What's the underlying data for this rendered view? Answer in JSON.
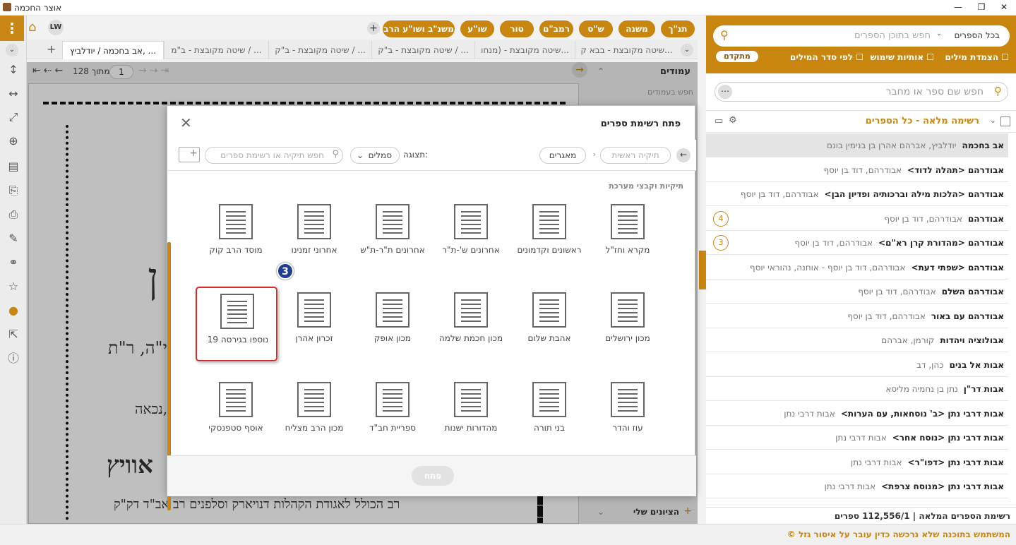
{
  "window": {
    "title": "אוצר החכמה",
    "minimize": "—",
    "maximize": "❐",
    "close": "✕"
  },
  "top": {
    "avatar": "LW",
    "nav_pills": [
      "תנ\"ך",
      "משנה",
      "ש\"ס",
      "רמב\"ם",
      "טור",
      "שו\"ע",
      "משנ\"ב ושו\"ע הרב"
    ]
  },
  "tabs": [
    "אב בחכמה / יודלביץ, ...",
    "שיטה מקובצת - ב\"מ / ...",
    "שיטה מקובצת - ב\"ק / ...",
    "שיטה מקובצת - ב\"ק / ...",
    "שיטה מקובצת - (מנחו...",
    "שיטה מקובצת - בבא ק..."
  ],
  "pager": {
    "current": "1",
    "total_label": "מתוך 128"
  },
  "pages_panel": {
    "title": "עמודים",
    "search_placeholder": "חפש בעמודים",
    "bookmarks": "הציונים שלי"
  },
  "right": {
    "scope": "בכל הספרים",
    "search_placeholder": "חפש בתוכן הספרים",
    "opts": [
      "הצמדת מילים",
      "אותיות שימוש",
      "לפי סדר המילים"
    ],
    "advanced": "מתקדם",
    "book_search_placeholder": "חפש שם ספר או מחבר",
    "list_title": "רשימה מלאה - כל הספרים",
    "rows": [
      {
        "b": "אב בחכמה",
        "a": "יודלביץ, אברהם אהרן בן בנימין בונם"
      },
      {
        "b": "אבודרהם <תהלה לדוד>",
        "a": "אבודרהם, דוד בן יוסף"
      },
      {
        "b": "אבודרהם <הלכות מילה וברכותיה ופדיון הבן>",
        "a": "אבודרהם, דוד בן יוסף"
      },
      {
        "b": "אבודרהם",
        "a": "אבודרהם, דוד בן יוסף",
        "n": "4"
      },
      {
        "b": "אבודרהם <מהדורת קרן רא\"ם>",
        "a": "אבודרהם, דוד בן יוסף",
        "n": "3"
      },
      {
        "b": "אבודרהם <שפתי דעת>",
        "a": "אבודרהם, דוד בן יוסף - אוחנה, נהוראי יוסף"
      },
      {
        "b": "אבודרהם השלם",
        "a": "אבודרהם, דוד בן יוסף"
      },
      {
        "b": "אבודרהם עם באור",
        "a": "אבודרהם, דוד בן יוסף"
      },
      {
        "b": "אבולוציה ויהדות",
        "a": "קורמן, אברהם"
      },
      {
        "b": "אבות אל בנים",
        "a": "כהן, דב"
      },
      {
        "b": "אבות דר\"ן",
        "a": "נתן בן נחמיה מליסא"
      },
      {
        "b": "אבות דרבי נתן <ב' נוסחאות, עם הערות>",
        "a": "אבות דרבי נתן"
      },
      {
        "b": "אבות דרבי נתן <נוסח אחר>",
        "a": "אבות דרבי נתן"
      },
      {
        "b": "אבות דרבי נתן <דפו\"ר>",
        "a": "אבות דרבי נתן"
      },
      {
        "b": "אבות דרבי נתן <מנוסח צרפת>",
        "a": "אבות דרבי נתן"
      }
    ],
    "footer": "רשימת הספרים המלאה | 112,556/1 ספרים"
  },
  "status": "המשתמש בתוכנה שלא נרכשה כדין עובר על איסור גזל ©",
  "dialog": {
    "title": "פתח רשימת ספרים",
    "crumb_root": "תיקיה ראשית",
    "crumb_cur": "מאגרים",
    "view_label": "תצוגה:",
    "view_value": "סמלים",
    "search_placeholder": "חפש תיקיה או רשימת ספרים",
    "section": "תיקיות וקבצי מערכת",
    "tiles": [
      "מקרא וחז\"ל",
      "ראשונים וקדמונים",
      "אחרונים ש'-ת\"ר",
      "אחרונים ת\"ר-ת\"ש",
      "אחרוני זמנינו",
      "מוסד הרב קוק",
      "מכון ירושלים",
      "אהבת שלום",
      "מכון חכמת שלמה",
      "מכון אופק",
      "זכרון אהרן",
      "נוספו בגירסה 19",
      "עוז והדר",
      "בני תורה",
      "מהדורות ישנות",
      "ספריית חב\"ד",
      "מכון הרב מצליח",
      "אוסף סטפנסקי"
    ],
    "open": "פתח",
    "marker": "3"
  },
  "doc": {
    "lines": [
      "ן",
      "י\"ה, ר\"ת",
      "נכאה,",
      "אוויץ",
      "רב הכולל לאגודת הקהלות דנויארק וסלפנים רב אב\"ד דק\"ק"
    ]
  }
}
